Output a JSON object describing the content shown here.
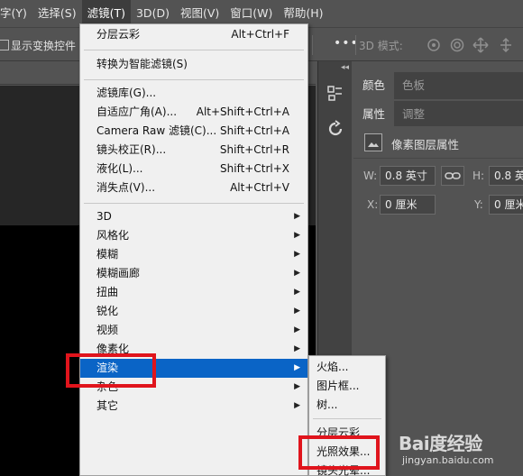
{
  "menubar": {
    "items": [
      "字(Y)",
      "选择(S)",
      "滤镜(T)",
      "3D(D)",
      "视图(V)",
      "窗口(W)",
      "帮助(H)"
    ],
    "active_index": 2
  },
  "options_bar": {
    "show_transform_label": "显示变换控件",
    "more_label": "•••",
    "mode_3d_label": "3D 模式:"
  },
  "filter_menu": {
    "items": [
      {
        "label": "分层云彩",
        "shortcut": "Alt+Ctrl+F"
      },
      {
        "label": "转换为智能滤镜(S)",
        "shortcut": ""
      },
      {
        "label": "滤镜库(G)...",
        "shortcut": ""
      },
      {
        "label": "自适应广角(A)...",
        "shortcut": "Alt+Shift+Ctrl+A"
      },
      {
        "label": "Camera Raw 滤镜(C)...",
        "shortcut": "Shift+Ctrl+A"
      },
      {
        "label": "镜头校正(R)...",
        "shortcut": "Shift+Ctrl+R"
      },
      {
        "label": "液化(L)...",
        "shortcut": "Shift+Ctrl+X"
      },
      {
        "label": "消失点(V)...",
        "shortcut": "Alt+Ctrl+V"
      },
      {
        "label": "3D",
        "shortcut": ""
      },
      {
        "label": "风格化",
        "shortcut": ""
      },
      {
        "label": "模糊",
        "shortcut": ""
      },
      {
        "label": "模糊画廊",
        "shortcut": ""
      },
      {
        "label": "扭曲",
        "shortcut": ""
      },
      {
        "label": "锐化",
        "shortcut": ""
      },
      {
        "label": "视频",
        "shortcut": ""
      },
      {
        "label": "像素化",
        "shortcut": ""
      },
      {
        "label": "渲染",
        "shortcut": ""
      },
      {
        "label": "杂色",
        "shortcut": ""
      },
      {
        "label": "其它",
        "shortcut": ""
      }
    ],
    "highlighted": "渲染"
  },
  "render_submenu": {
    "items": [
      "火焰...",
      "图片框...",
      "树...",
      "分层云彩",
      "光照效果...",
      "镜头光晕..."
    ]
  },
  "panels": {
    "top_tabs": [
      "颜色",
      "色板"
    ],
    "bottom_tabs": [
      "属性",
      "调整"
    ],
    "properties_title": "像素图层属性",
    "w_label": "W:",
    "w_value": "0.8 英寸",
    "h_label": "H:",
    "h_value": "0.8 英寸",
    "x_label": "X:",
    "x_value": "0 厘米",
    "y_label": "Y:",
    "y_value": "0 厘米"
  },
  "watermark": {
    "logo": "Bai度经验",
    "url": "jingyan.baidu.com"
  },
  "colors": {
    "accent_highlight": "#0a64c6",
    "annotation_red": "#e0141c"
  }
}
